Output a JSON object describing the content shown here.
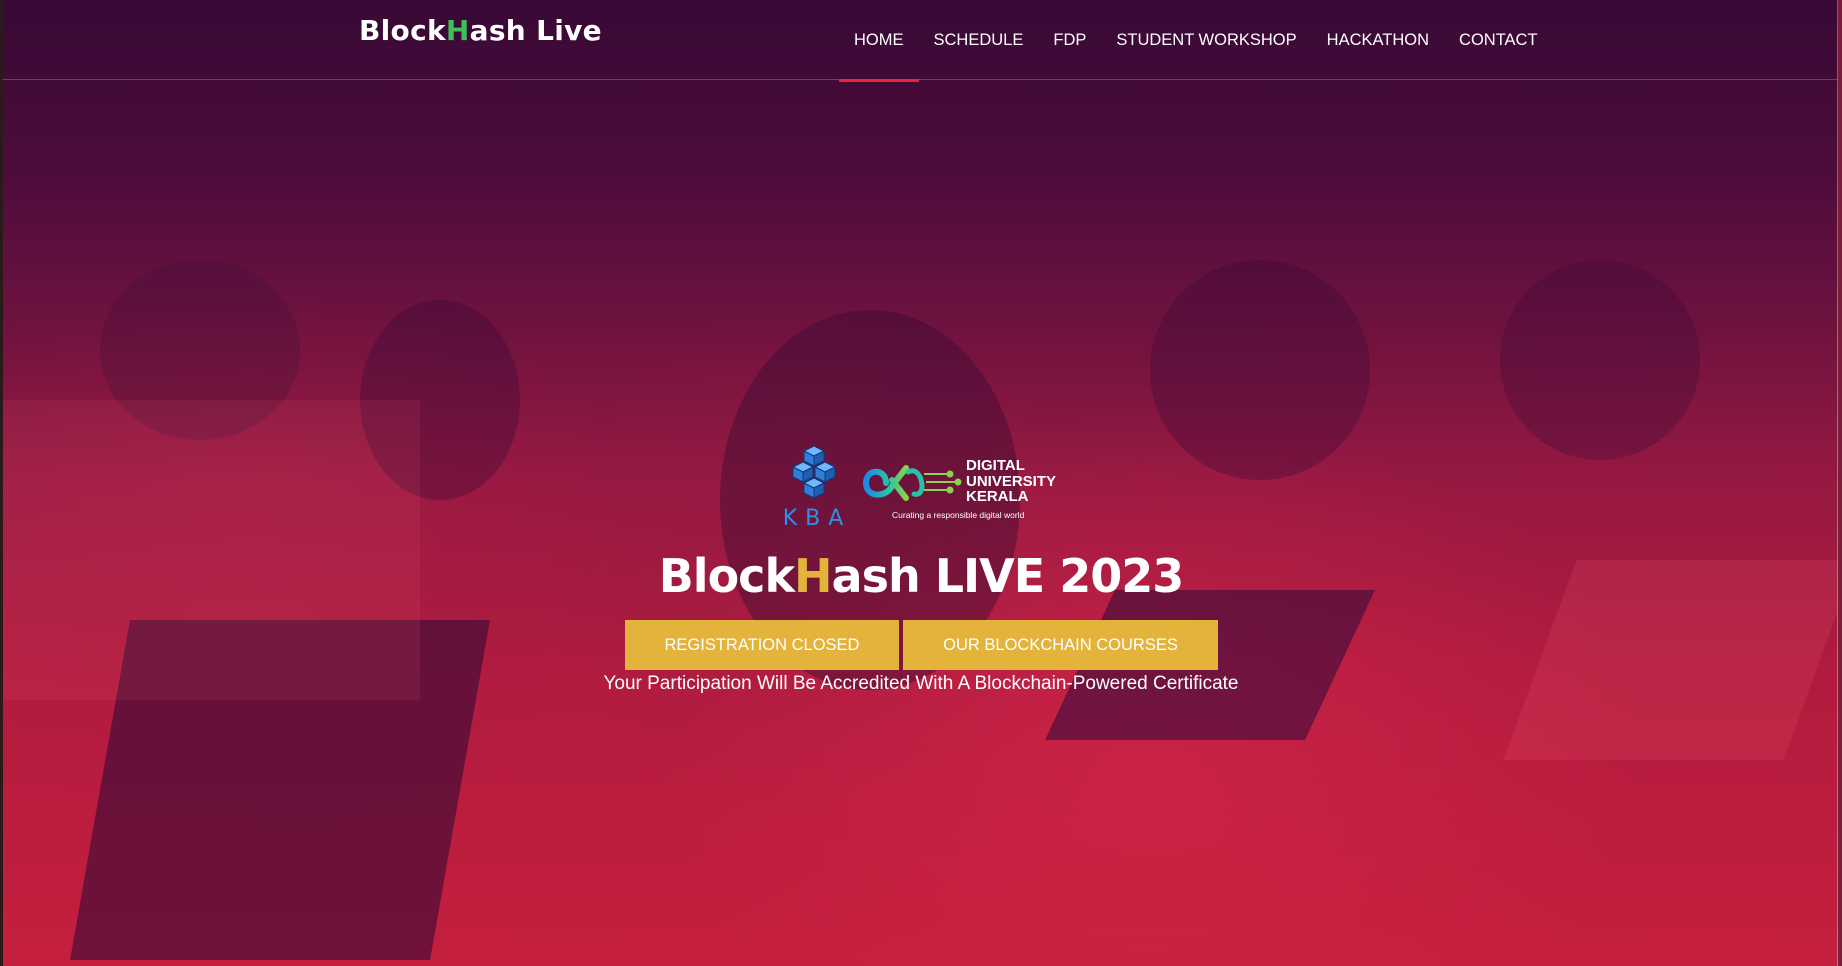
{
  "brand": {
    "part1": "Block",
    "highlight": "H",
    "part2": "ash Live",
    "highlight_color": "#3fbf5a"
  },
  "nav": {
    "items": [
      {
        "label": "HOME",
        "active": true
      },
      {
        "label": "SCHEDULE",
        "active": false
      },
      {
        "label": "FDP",
        "active": false
      },
      {
        "label": "STUDENT WORKSHOP",
        "active": false
      },
      {
        "label": "HACKATHON",
        "active": false
      },
      {
        "label": "CONTACT",
        "active": false
      }
    ],
    "active_indicator_color": "#e5263d"
  },
  "logos": {
    "kba": {
      "text": "KBA",
      "icon": "cubes-logo-icon",
      "color": "#2f8fe8"
    },
    "duk": {
      "name_lines": [
        "DIGITAL",
        "UNIVERSITY",
        "KERALA"
      ],
      "tagline": "Curating a responsible digital world",
      "icon": "duk-infinity-logo-icon"
    }
  },
  "hero": {
    "title_part1": "Block",
    "title_highlight": "H",
    "title_part2": "ash LIVE 2023",
    "highlight_color": "#e4b33c",
    "buttons": {
      "registration": "REGISTRATION CLOSED",
      "courses": "OUR BLOCKCHAIN COURSES"
    },
    "button_color": "#e4b33c",
    "subtitle": "Your Participation Will Be Accredited With A Blockchain-Powered Certificate"
  }
}
